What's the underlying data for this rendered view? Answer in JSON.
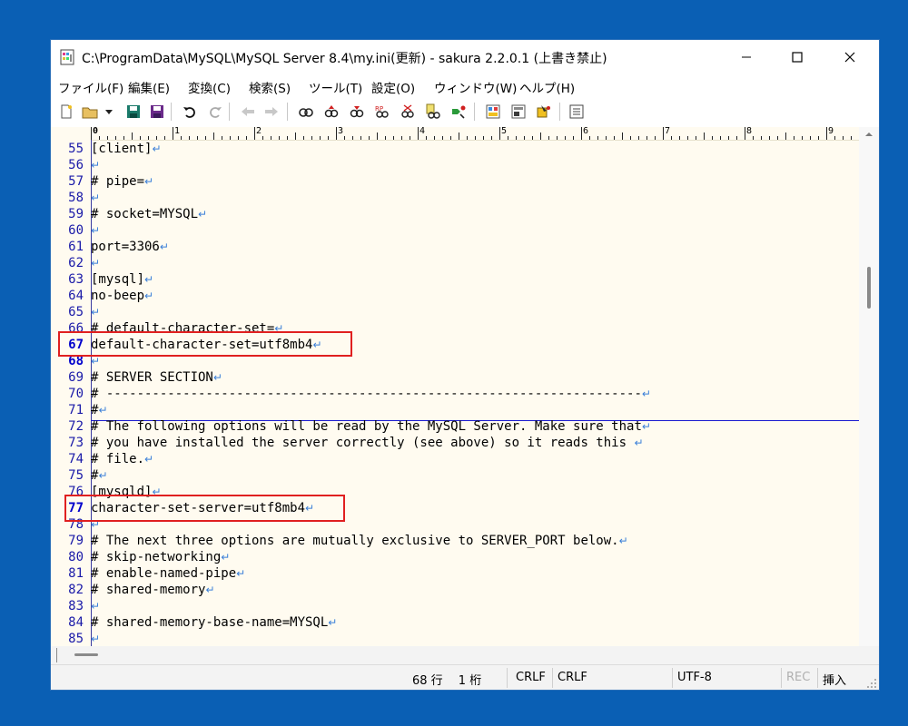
{
  "window": {
    "title": "C:\\ProgramData\\MySQL\\MySQL Server 8.4\\my.ini(更新) - sakura 2.2.0.1 (上書き禁止)"
  },
  "menu": [
    "ファイル(F)",
    "編集(E)",
    "変換(C)",
    "検索(S)",
    "ツール(T)",
    "設定(O)",
    "ウィンドウ(W)",
    "ヘルプ(H)"
  ],
  "ruler": [
    "0",
    "1",
    "2",
    "3",
    "4",
    "5",
    "6",
    "7",
    "8",
    "9"
  ],
  "lines": [
    {
      "num": "55",
      "text": "[client]"
    },
    {
      "num": "56",
      "text": ""
    },
    {
      "num": "57",
      "text": "# pipe="
    },
    {
      "num": "58",
      "text": ""
    },
    {
      "num": "59",
      "text": "# socket=MYSQL"
    },
    {
      "num": "60",
      "text": ""
    },
    {
      "num": "61",
      "text": "port=3306"
    },
    {
      "num": "62",
      "text": ""
    },
    {
      "num": "63",
      "text": "[mysql]"
    },
    {
      "num": "64",
      "text": "no-beep"
    },
    {
      "num": "65",
      "text": ""
    },
    {
      "num": "66",
      "text": "# default-character-set="
    },
    {
      "num": "67",
      "text": "default-character-set=utf8mb4"
    },
    {
      "num": "68",
      "text": ""
    },
    {
      "num": "69",
      "text": "# SERVER SECTION"
    },
    {
      "num": "70",
      "text": "# ----------------------------------------------------------------------"
    },
    {
      "num": "71",
      "text": "#"
    },
    {
      "num": "72",
      "text": "# The following options will be read by the MySQL Server. Make sure that"
    },
    {
      "num": "73",
      "text": "# you have installed the server correctly (see above) so it reads this "
    },
    {
      "num": "74",
      "text": "# file."
    },
    {
      "num": "75",
      "text": "#"
    },
    {
      "num": "76",
      "text": "[mysqld]"
    },
    {
      "num": "77",
      "text": "character-set-server=utf8mb4"
    },
    {
      "num": "78",
      "text": ""
    },
    {
      "num": "79",
      "text": "# The next three options are mutually exclusive to SERVER_PORT below."
    },
    {
      "num": "80",
      "text": "# skip-networking"
    },
    {
      "num": "81",
      "text": "# enable-named-pipe"
    },
    {
      "num": "82",
      "text": "# shared-memory"
    },
    {
      "num": "83",
      "text": ""
    },
    {
      "num": "84",
      "text": "# shared-memory-base-name=MYSQL"
    },
    {
      "num": "85",
      "text": ""
    }
  ],
  "eol_mark": "↵",
  "current_line": "68",
  "status": {
    "position": "68 行　 1 桁",
    "eol1": "CRLF",
    "eol2": "CRLF",
    "encoding": "UTF-8",
    "rec": "REC",
    "mode": "挿入"
  },
  "colors": {
    "highlight": "#e02020",
    "line_numbers": "#1a1aa8",
    "eol_marks": "#3a7fd8",
    "editor_bg": "#fffbf0",
    "desktop": "#0a5fb4"
  }
}
